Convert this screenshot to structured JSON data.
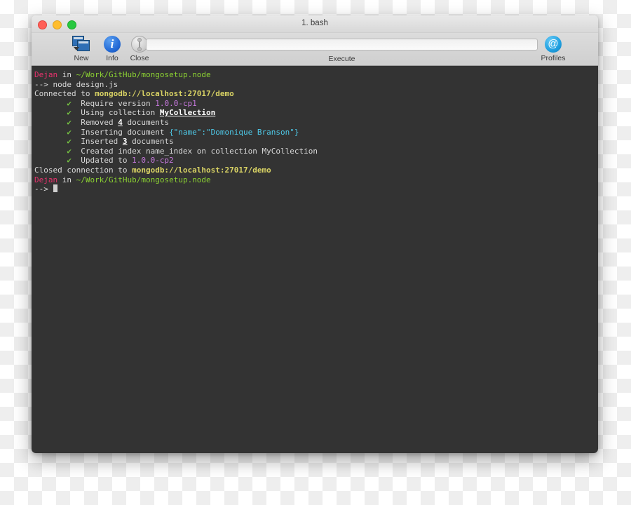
{
  "window": {
    "title": "1. bash",
    "traffic_lights": [
      {
        "name": "close",
        "color": "#ff5f57"
      },
      {
        "name": "minimize",
        "color": "#ffbd2e"
      },
      {
        "name": "maximize",
        "color": "#28c840"
      }
    ]
  },
  "toolbar": {
    "items": [
      {
        "label": "New",
        "icon": "new-window-icon"
      },
      {
        "label": "Info",
        "icon": "info-icon"
      },
      {
        "label": "Close",
        "icon": "close-session-icon"
      }
    ],
    "execute": {
      "label": "Execute",
      "value": "",
      "placeholder": ""
    },
    "profiles": {
      "label": "Profiles",
      "icon": "at-sign-icon"
    }
  },
  "terminal": {
    "colors": {
      "background": "#333333",
      "foreground": "#d8d8d8",
      "user": "#e8336d",
      "path": "#8cd232",
      "url": "#d8d264",
      "version": "#c678dd",
      "check": "#76c442",
      "json": "#4ec9e8"
    },
    "lines": [
      {
        "segments": [
          {
            "text": "Dejan",
            "color": "#e8336d"
          },
          {
            "text": " in ",
            "color": "#d8d8d8"
          },
          {
            "text": "~/Work/GitHub/mongosetup.node",
            "color": "#8cd232"
          }
        ]
      },
      {
        "segments": [
          {
            "text": "--> node design.js",
            "color": "#d8d8d8"
          }
        ]
      },
      {
        "segments": [
          {
            "text": "Connected to ",
            "color": "#d8d8d8"
          },
          {
            "text": "mongodb://localhost:27017/demo",
            "color": "#d8d264",
            "bold": true
          }
        ]
      },
      {
        "segments": [
          {
            "text": "       ",
            "color": "#d8d8d8"
          },
          {
            "text": "✔",
            "color": "#76c442",
            "bold": true
          },
          {
            "text": "  Require version ",
            "color": "#d8d8d8"
          },
          {
            "text": "1.0.0-cp1",
            "color": "#c678dd"
          }
        ]
      },
      {
        "segments": [
          {
            "text": "       ",
            "color": "#d8d8d8"
          },
          {
            "text": "✔",
            "color": "#76c442",
            "bold": true
          },
          {
            "text": "  Using collection ",
            "color": "#d8d8d8"
          },
          {
            "text": "MyCollection",
            "color": "#ffffff",
            "underline": true
          }
        ]
      },
      {
        "segments": [
          {
            "text": "       ",
            "color": "#d8d8d8"
          },
          {
            "text": "✔",
            "color": "#76c442",
            "bold": true
          },
          {
            "text": "  Removed ",
            "color": "#d8d8d8"
          },
          {
            "text": "4",
            "color": "#ffffff",
            "underline": true
          },
          {
            "text": " documents",
            "color": "#d8d8d8"
          }
        ]
      },
      {
        "segments": [
          {
            "text": "       ",
            "color": "#d8d8d8"
          },
          {
            "text": "✔",
            "color": "#76c442",
            "bold": true
          },
          {
            "text": "  Inserting document ",
            "color": "#d8d8d8"
          },
          {
            "text": "{\"name\":\"Domonique Branson\"}",
            "color": "#4ec9e8"
          }
        ]
      },
      {
        "segments": [
          {
            "text": "       ",
            "color": "#d8d8d8"
          },
          {
            "text": "✔",
            "color": "#76c442",
            "bold": true
          },
          {
            "text": "  Inserted ",
            "color": "#d8d8d8"
          },
          {
            "text": "3",
            "color": "#ffffff",
            "underline": true
          },
          {
            "text": " documents",
            "color": "#d8d8d8"
          }
        ]
      },
      {
        "segments": [
          {
            "text": "       ",
            "color": "#d8d8d8"
          },
          {
            "text": "✔",
            "color": "#76c442",
            "bold": true
          },
          {
            "text": "  Created index name_index on collection MyCollection",
            "color": "#d8d8d8"
          }
        ]
      },
      {
        "segments": [
          {
            "text": "       ",
            "color": "#d8d8d8"
          },
          {
            "text": "✔",
            "color": "#76c442",
            "bold": true
          },
          {
            "text": "  Updated to ",
            "color": "#d8d8d8"
          },
          {
            "text": "1.0.0-cp2",
            "color": "#c678dd"
          }
        ]
      },
      {
        "segments": [
          {
            "text": "Closed connection to ",
            "color": "#d8d8d8"
          },
          {
            "text": "mongodb://localhost:27017/demo",
            "color": "#d8d264",
            "bold": true
          }
        ]
      },
      {
        "segments": [
          {
            "text": "Dejan",
            "color": "#e8336d"
          },
          {
            "text": " in ",
            "color": "#d8d8d8"
          },
          {
            "text": "~/Work/GitHub/mongosetup.node",
            "color": "#8cd232"
          }
        ]
      },
      {
        "segments": [
          {
            "text": "--> ",
            "color": "#d8d8d8"
          }
        ],
        "cursor": true
      }
    ]
  }
}
